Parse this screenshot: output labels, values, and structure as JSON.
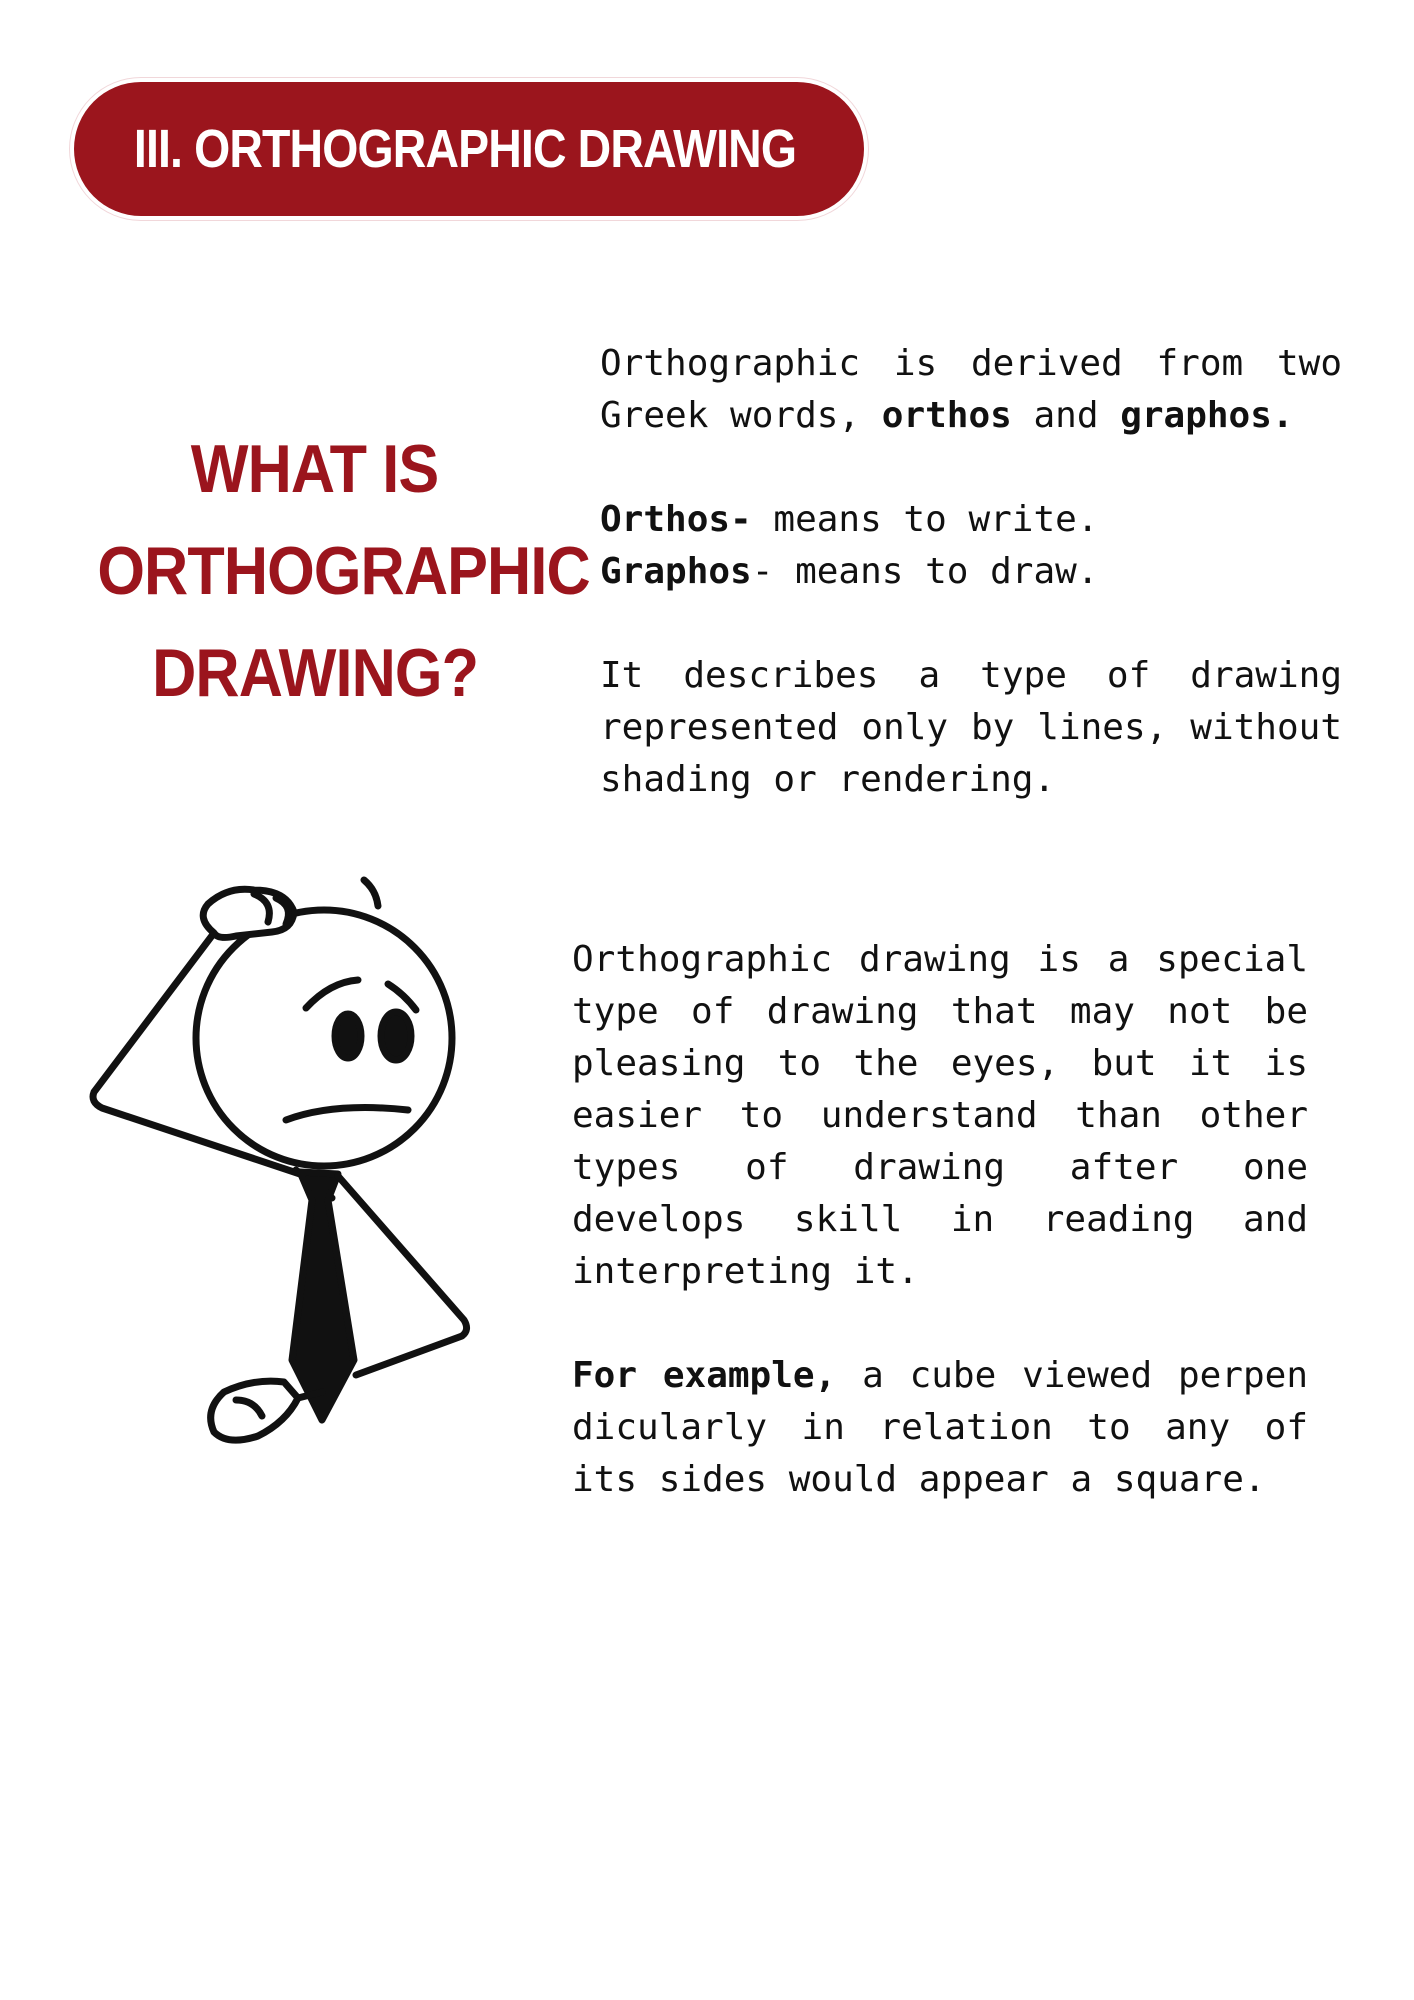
{
  "section": {
    "title": "III. ORTHOGRAPHIC DRAWING"
  },
  "heading": {
    "line1": "WHAT IS",
    "line2": "ORTHOGRAPHIC",
    "line3": "DRAWING?"
  },
  "intro": {
    "p1_before": "Orthographic is derived from two Greek words, ",
    "p1_bold1": "orthos",
    "p1_and": " and ",
    "p1_bold2": "graphos.",
    "orthos_term": "Orthos-",
    "orthos_def": " means to write.",
    "graphos_term": "Graphos",
    "graphos_def": "- means to draw.",
    "p3": "It describes a type of drawing represented only by lines, without shading or rendering."
  },
  "body": {
    "p1": "Orthographic drawing is a special type of drawing that may not be pleasing to the eyes, but it is easier to understand than other types of drawing after one develops skill in reading and interpreting it.",
    "example_bold": "For example,",
    "example_rest": " a cube viewed perpen dicularly in relation to any of its sides would appear a square."
  },
  "colors": {
    "accent": "#9b151d",
    "text": "#111111"
  },
  "illustration": {
    "icon": "confused-stick-figure-icon"
  }
}
